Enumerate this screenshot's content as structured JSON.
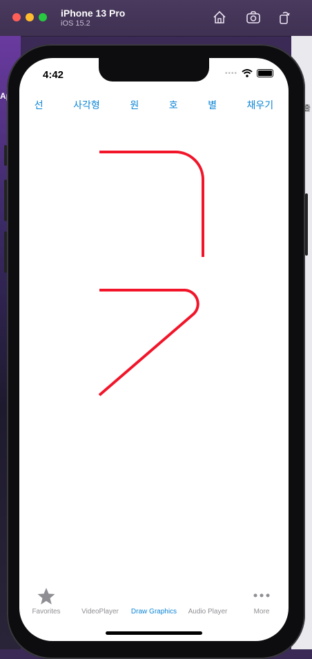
{
  "window": {
    "title": "iPhone 13 Pro",
    "subtitle": "iOS 15.2"
  },
  "background": {
    "left_text": "AppD",
    "right_text": "제출"
  },
  "status_bar": {
    "time": "4:42"
  },
  "toolbar": {
    "buttons": [
      {
        "label": "선"
      },
      {
        "label": "사각형"
      },
      {
        "label": "원"
      },
      {
        "label": "호"
      },
      {
        "label": "별"
      },
      {
        "label": "채우기"
      }
    ]
  },
  "drawing": {
    "stroke_color": "#f2152a"
  },
  "tabbar": {
    "items": [
      {
        "label": "Favorites",
        "icon": "star-icon",
        "active": false
      },
      {
        "label": "VideoPlayer",
        "icon": "",
        "active": false
      },
      {
        "label": "Draw Graphics",
        "icon": "",
        "active": true
      },
      {
        "label": "Audio Player",
        "icon": "",
        "active": false
      },
      {
        "label": "More",
        "icon": "more-icon",
        "active": false
      }
    ]
  },
  "colors": {
    "accent": "#0a84d6",
    "inactive": "#8e8e93"
  }
}
